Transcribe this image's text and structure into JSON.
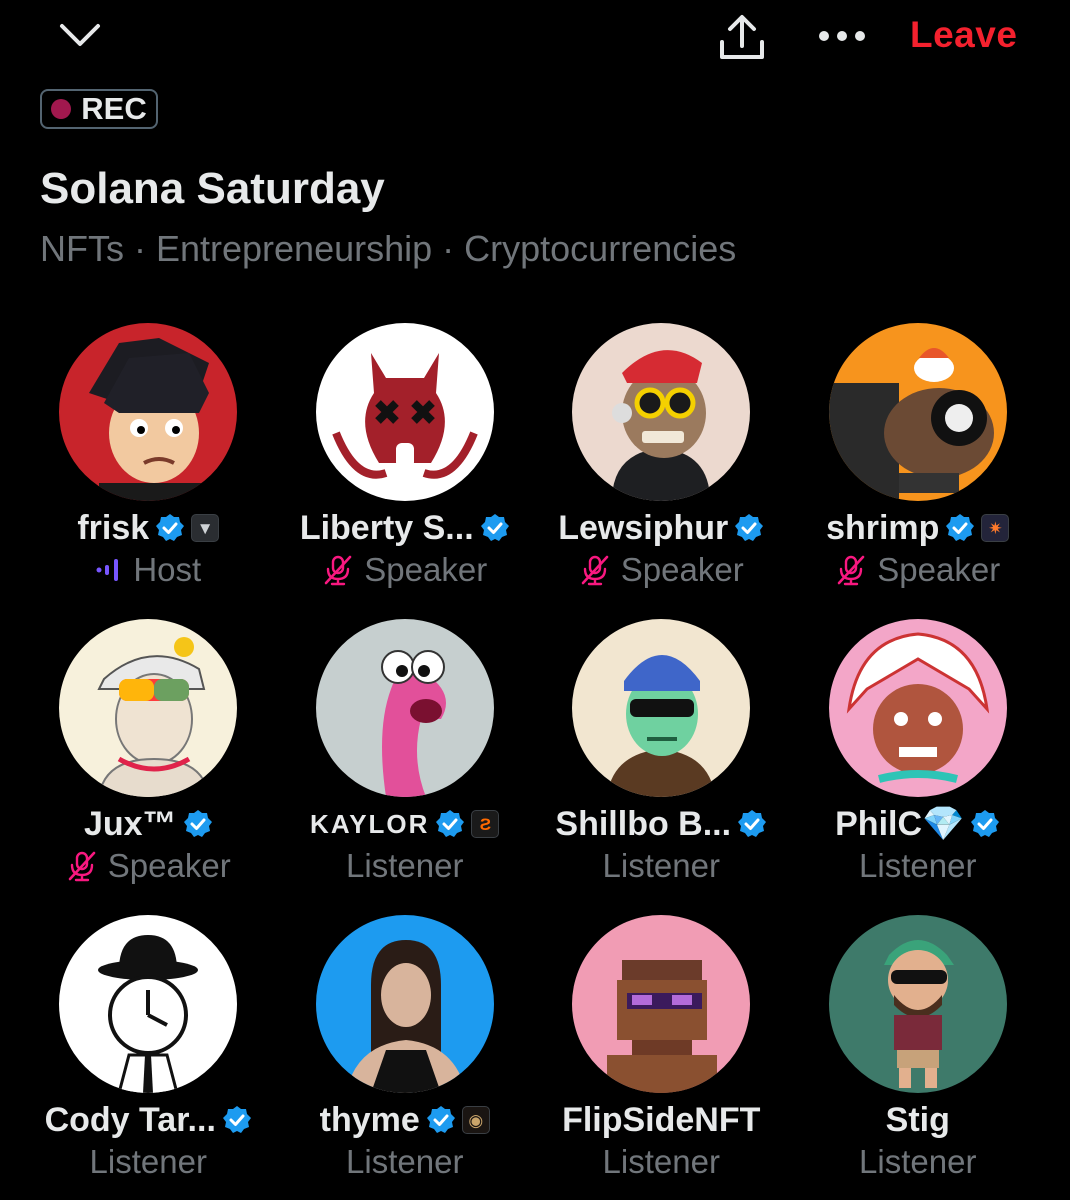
{
  "header": {
    "collapse_icon": "chevron-down-icon",
    "share_icon": "share-icon",
    "more_icon": "more-horizontal-icon",
    "leave_label": "Leave",
    "leave_color": "#f4212e"
  },
  "space": {
    "rec_label": "REC",
    "title": "Solana Saturday",
    "topics": "NFTs · Entrepreneurship · Cryptocurrencies"
  },
  "participants": [
    {
      "name": "frisk",
      "verified": true,
      "affiliate": "wolf-badge",
      "role": "Host",
      "role_icon": "speaking-bars-icon",
      "avatar_color": "#c8242b"
    },
    {
      "name": "Liberty S...",
      "verified": true,
      "affiliate": "",
      "role": "Speaker",
      "role_icon": "mic-off-icon",
      "avatar_color": "#ffffff"
    },
    {
      "name": "Lewsiphur",
      "verified": true,
      "affiliate": "",
      "role": "Speaker",
      "role_icon": "mic-off-icon",
      "avatar_color": "#ecd9cf"
    },
    {
      "name": "shrimp",
      "verified": true,
      "affiliate": "star-badge",
      "role": "Speaker",
      "role_icon": "mic-off-icon",
      "avatar_color": "#f7941d"
    },
    {
      "name": "Jux™",
      "verified": true,
      "affiliate": "",
      "role": "Speaker",
      "role_icon": "mic-off-icon",
      "avatar_color": "#f7f1dc"
    },
    {
      "name": "KAYLOR",
      "verified": true,
      "affiliate": "orange-s-badge",
      "role": "Listener",
      "role_icon": "",
      "avatar_color": "#c6cfcf"
    },
    {
      "name": "Shillbo B...",
      "verified": true,
      "affiliate": "",
      "role": "Listener",
      "role_icon": "",
      "avatar_color": "#f2e6d0"
    },
    {
      "name": "PhilC💎",
      "verified": true,
      "affiliate": "",
      "role": "Listener",
      "role_icon": "",
      "avatar_color": "#f3a6c8"
    },
    {
      "name": "Cody Tar...",
      "verified": true,
      "affiliate": "",
      "role": "Listener",
      "role_icon": "",
      "avatar_color": "#ffffff"
    },
    {
      "name": "thyme",
      "verified": true,
      "affiliate": "coin-badge",
      "role": "Listener",
      "role_icon": "",
      "avatar_color": "#1d9bf0"
    },
    {
      "name": "FlipSideNFT",
      "verified": false,
      "affiliate": "",
      "role": "Listener",
      "role_icon": "",
      "avatar_color": "#f19cb4"
    },
    {
      "name": "Stig",
      "verified": false,
      "affiliate": "",
      "role": "Listener",
      "role_icon": "",
      "avatar_color": "#3e7a6a"
    }
  ],
  "colors": {
    "verified_blue": "#1d9bf0",
    "mute_pink": "#f91880",
    "host_purple": "#7856ff",
    "muted_text": "#71767b"
  }
}
